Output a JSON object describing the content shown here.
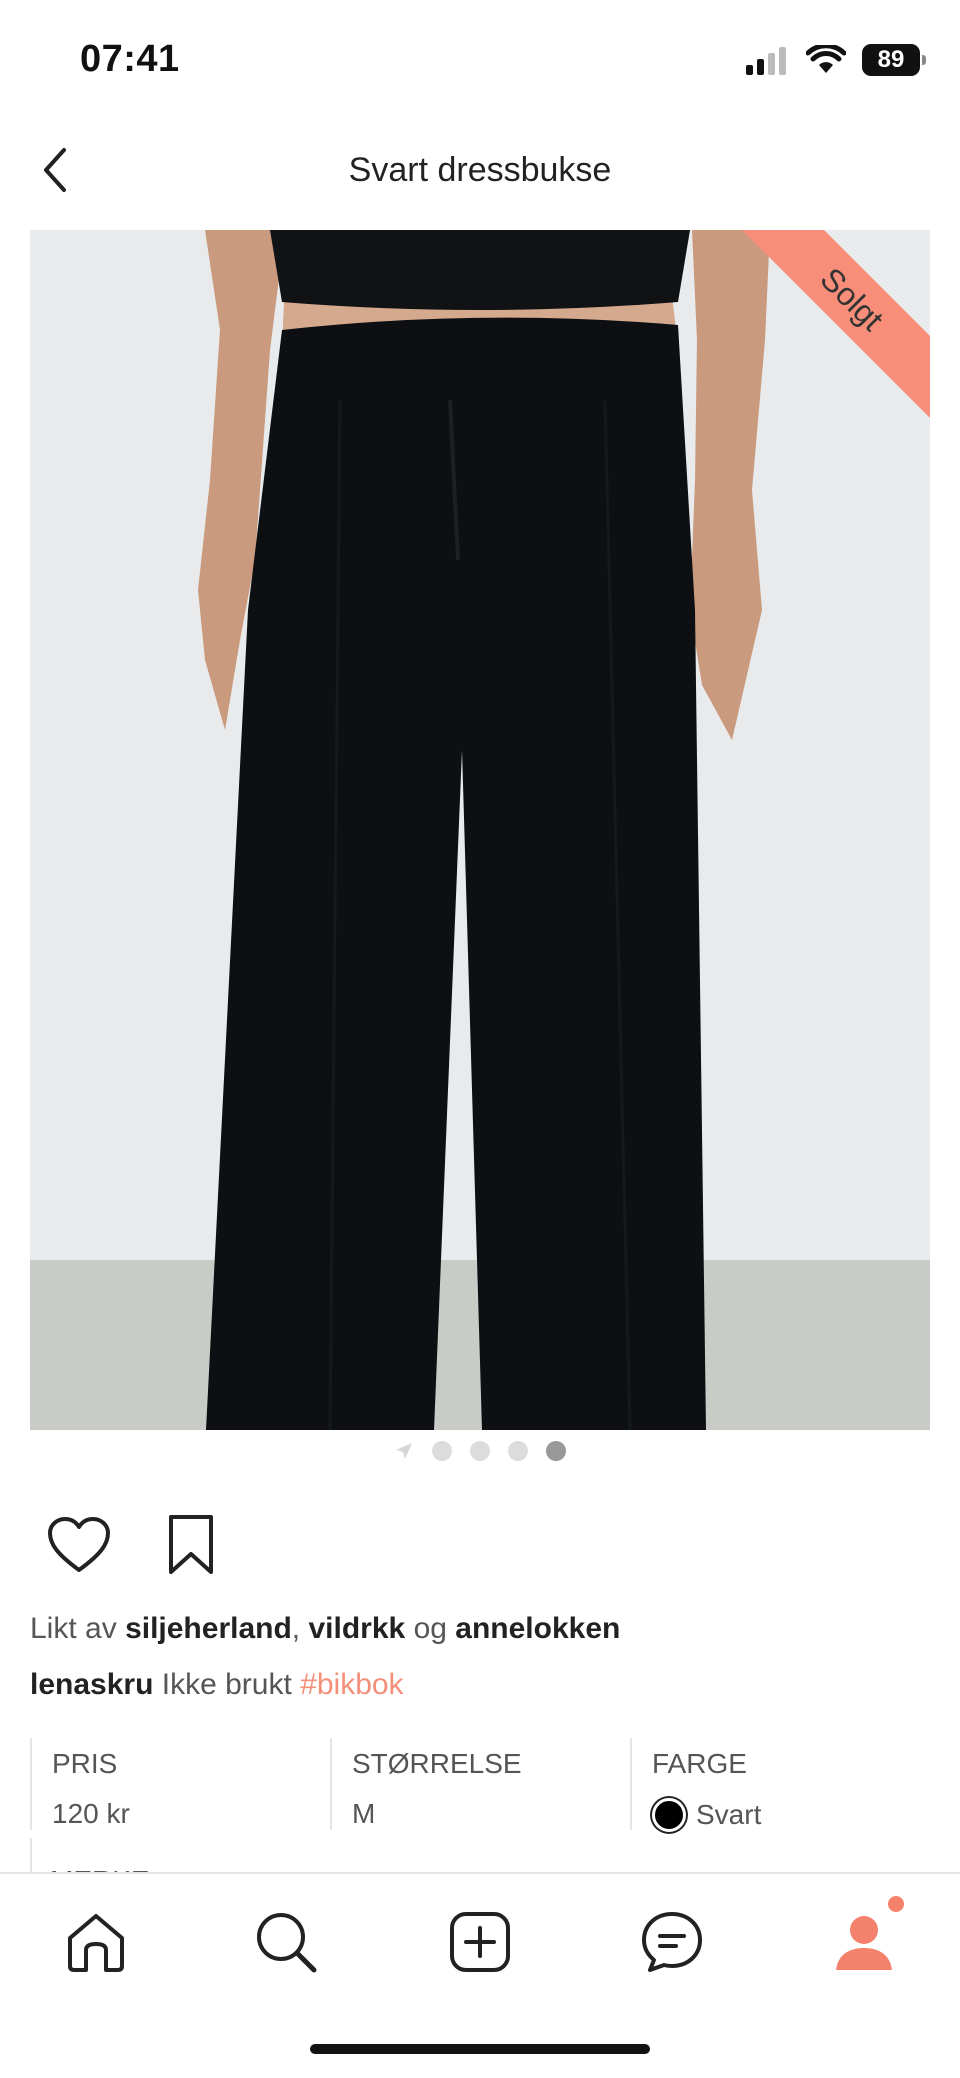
{
  "status_bar": {
    "time": "07:41",
    "battery": "89"
  },
  "header": {
    "title": "Svart dressbukse"
  },
  "photo": {
    "badge": "Solgt",
    "page_count": 4,
    "active_page": 4
  },
  "likes": {
    "prefix": "Likt av",
    "users": [
      "siljeherland",
      "vildrkk",
      "annelokken"
    ],
    "separator": ",",
    "conjunction": "og"
  },
  "caption": {
    "user": "lenaskru",
    "text": "Ikke brukt",
    "hashtag": "#bikbok"
  },
  "details": {
    "price": {
      "label": "PRIS",
      "value": "120 kr"
    },
    "size": {
      "label": "STØRRELSE",
      "value": "M"
    },
    "color": {
      "label": "FARGE",
      "value": "Svart",
      "swatch": "#000000"
    },
    "brand": {
      "label": "MERKE"
    }
  },
  "tabbar": {
    "items": [
      "home-icon",
      "search-icon",
      "add-icon",
      "messages-icon",
      "profile-icon"
    ],
    "accent": "#f4816b"
  },
  "colors": {
    "accent": "#f48f7a",
    "ribbon": "#f88e79"
  }
}
